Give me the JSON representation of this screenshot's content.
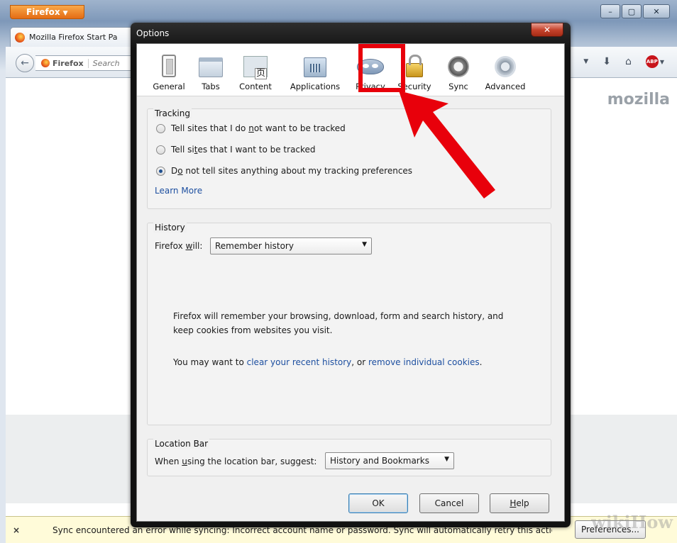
{
  "browser": {
    "menu_button": "Firefox",
    "tab_title": "Mozilla Firefox Start Pa",
    "url_identity": "Firefox",
    "search_placeholder": "Search",
    "brand_text": "mozilla",
    "notification_close": "×",
    "notification_text": "Sync encountered an error while syncing: Incorrect account name or password. Sync will automatically retry this action.",
    "preferences_button": "Preferences..."
  },
  "window_controls": {
    "minimize": "–",
    "maximize": "▢",
    "close": "✕"
  },
  "dialog": {
    "title": "Options",
    "close": "✕",
    "panes": [
      {
        "label": "General",
        "icon": "general-icon"
      },
      {
        "label": "Tabs",
        "icon": "tabs-icon"
      },
      {
        "label": "Content",
        "icon": "content-icon"
      },
      {
        "label": "Applications",
        "icon": "applications-icon"
      },
      {
        "label": "Privacy",
        "icon": "privacy-mask-icon"
      },
      {
        "label": "Security",
        "icon": "padlock-icon"
      },
      {
        "label": "Sync",
        "icon": "sync-icon"
      },
      {
        "label": "Advanced",
        "icon": "gear-icon"
      }
    ],
    "selected_pane": "Privacy",
    "tracking": {
      "heading": "Tracking",
      "options": [
        {
          "pre": "Tell sites that I do ",
          "accel": "n",
          "post": "ot want to be tracked",
          "selected": false
        },
        {
          "pre": "Tell si",
          "accel": "t",
          "post": "es that I want to be tracked",
          "selected": false
        },
        {
          "pre": "D",
          "accel": "o",
          "post": " not tell sites anything about my tracking preferences",
          "selected": true
        }
      ],
      "learn_more": "Learn More"
    },
    "history": {
      "heading": "History",
      "label_pre": "Firefox ",
      "label_accel": "w",
      "label_post": "ill:",
      "select_value": "Remember history",
      "description_line1": "Firefox will remember your browsing, download, form and search history, and",
      "description_line2": "keep cookies from websites you visit.",
      "may_want": "You may want to ",
      "clear_link": "clear your recent history",
      "or_text": ", or ",
      "remove_link": "remove individual cookies",
      "period": "."
    },
    "location_bar": {
      "heading": "Location Bar",
      "label_pre": "When ",
      "label_accel": "u",
      "label_post": "sing the location bar, suggest:",
      "select_value": "History and Bookmarks"
    },
    "buttons": {
      "ok": "OK",
      "cancel": "Cancel",
      "help_accel": "H",
      "help_rest": "elp"
    }
  },
  "watermark": "wikiHow",
  "colors": {
    "annotation_red": "#e8000b",
    "link_blue": "#1d4fa0",
    "firefox_orange": "#e46c13"
  }
}
